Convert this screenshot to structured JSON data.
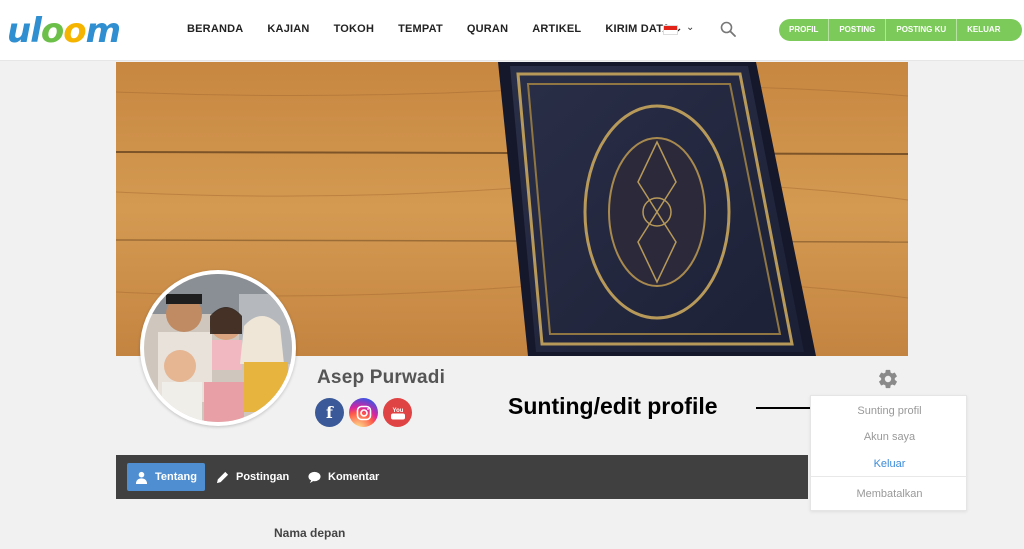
{
  "brand": {
    "logo_parts": [
      "u",
      "l",
      "oo",
      "m"
    ],
    "logo_colors": [
      "#2f8fd0",
      "#6cc04a",
      "#f4b400"
    ]
  },
  "nav": {
    "items": [
      "BERANDA",
      "KAJIAN",
      "TOKOH",
      "TEMPAT",
      "QURAN",
      "ARTIKEL",
      "KIRIM DATA"
    ],
    "language_flag": "indonesia-flag-icon"
  },
  "user_menu": {
    "items": [
      "PROFIL",
      "POSTING",
      "POSTING KU",
      "KELUAR"
    ],
    "color": "#7ccb5a"
  },
  "profile": {
    "name": "Asep Purwadi",
    "social": {
      "facebook": "f",
      "instagram": "instagram-icon",
      "youtube": "You"
    }
  },
  "annotation": {
    "text": "Sunting/edit profile"
  },
  "dropdown": {
    "items": [
      "Sunting profil",
      "Akun saya",
      "Keluar"
    ],
    "cancel": "Membatalkan"
  },
  "tabs": [
    {
      "label": "Tentang",
      "icon": "user-icon",
      "active": true
    },
    {
      "label": "Postingan",
      "icon": "pencil-icon",
      "active": false
    },
    {
      "label": "Komentar",
      "icon": "speech-bubble-icon",
      "active": false
    }
  ],
  "form": {
    "first_name_label": "Nama depan"
  },
  "colors": {
    "accent_blue": "#4e8ed1",
    "tab_bar": "#404040",
    "link_blue": "#3b8bd8"
  }
}
